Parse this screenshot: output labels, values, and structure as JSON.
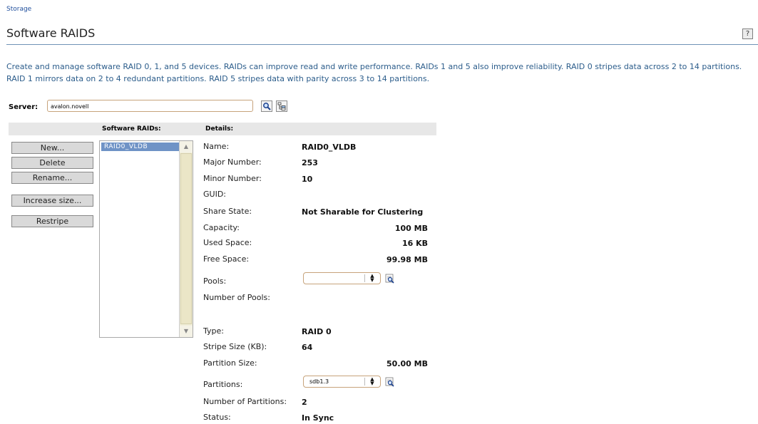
{
  "breadcrumb": "Storage",
  "page_title": "Software RAIDS",
  "help_label": "?",
  "description": "Create and manage software RAID 0, 1, and 5 devices. RAIDs can improve read and write performance. RAIDs 1 and 5 also improve reliability. RAID 0 stripes data across 2 to 14 partitions. RAID 1 mirrors data on 2 to 4 redundant partitions. RAID 5 stripes data with parity across 3 to 14 partitions.",
  "server": {
    "label": "Server:",
    "value": "avalon.novell"
  },
  "headers": {
    "software_raids": "Software RAIDs:",
    "details": "Details:"
  },
  "actions": {
    "new": "New...",
    "delete": "Delete",
    "rename": "Rename...",
    "increase_size": "Increase size...",
    "restripe": "Restripe"
  },
  "raid_list": [
    "RAID0_VLDB"
  ],
  "details": {
    "name": {
      "label": "Name:",
      "value": "RAID0_VLDB"
    },
    "major": {
      "label": "Major Number:",
      "value": "253"
    },
    "minor": {
      "label": "Minor Number:",
      "value": "10"
    },
    "guid": {
      "label": "GUID:",
      "value": ""
    },
    "share_state": {
      "label": "Share State:",
      "value": "Not Sharable for Clustering"
    },
    "capacity": {
      "label": "Capacity:",
      "value": "100 MB"
    },
    "used_space": {
      "label": "Used Space:",
      "value": "16 KB"
    },
    "free_space": {
      "label": "Free Space:",
      "value": "99.98 MB"
    },
    "pools": {
      "label": "Pools:",
      "value": ""
    },
    "num_pools": {
      "label": "Number of Pools:",
      "value": ""
    },
    "type": {
      "label": "Type:",
      "value": "RAID 0"
    },
    "stripe_size": {
      "label": "Stripe Size (KB):",
      "value": "64"
    },
    "partition_size": {
      "label": "Partition Size:",
      "value": "50.00 MB"
    },
    "partitions": {
      "label": "Partitions:",
      "value": "sdb1.3"
    },
    "num_partitions": {
      "label": "Number of Partitions:",
      "value": "2"
    },
    "status": {
      "label": "Status:",
      "value": "In Sync"
    }
  }
}
